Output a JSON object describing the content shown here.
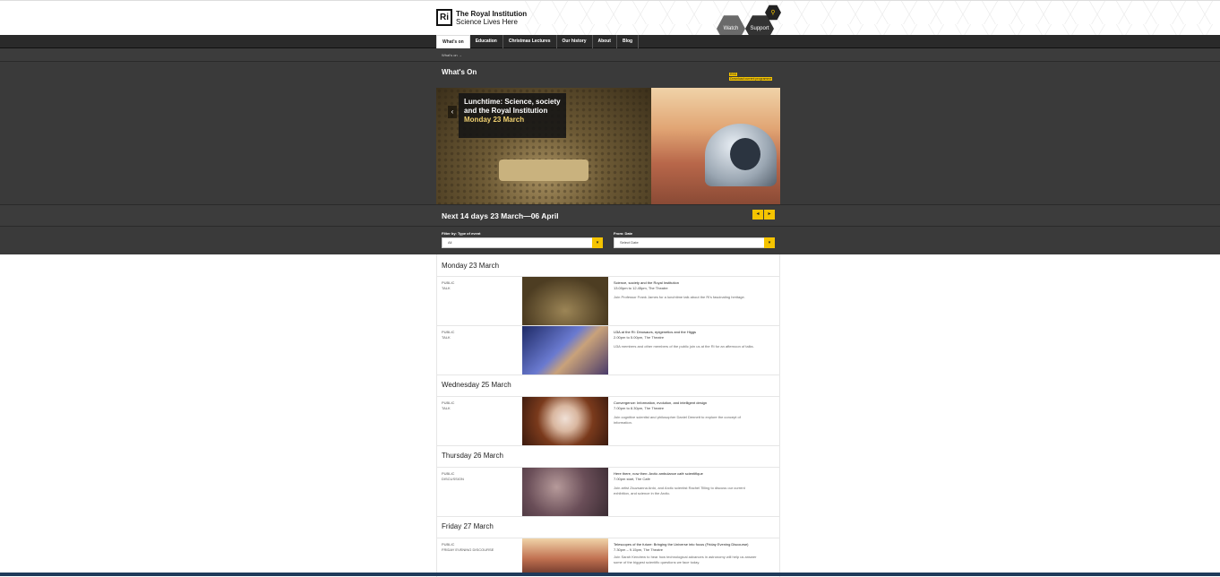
{
  "header": {
    "logo_mark": "Ri",
    "logo_line1": "The Royal Institution",
    "logo_line2": "Science Lives Here",
    "watch_label": "Watch",
    "support_label": "Support",
    "small_hex_icon": "search-icon"
  },
  "nav": {
    "items": [
      "What's on",
      "Education",
      "Christmas Lectures",
      "Our history",
      "About",
      "Blog"
    ]
  },
  "breadcrumb": "What's on →",
  "page_title": "What's On",
  "rss_label": "RSS",
  "download_label": "Download current programme",
  "hero": {
    "title": "Lunchtime: Science, society and the Royal Institution",
    "date": "Monday 23 March",
    "prev_arrow": "‹"
  },
  "next_days": {
    "title": "Next 14 days 23 March—06 April",
    "prev": "◂",
    "next": "▸"
  },
  "filters": {
    "type_label": "Filter by: Type of event",
    "type_value": "All",
    "date_label": "From: Date",
    "date_value": "Select Date",
    "caret": "▾"
  },
  "days": [
    {
      "label": "Monday 23 March"
    },
    {
      "label": "Wednesday 25 March"
    },
    {
      "label": "Thursday 26 March"
    },
    {
      "label": "Friday 27 March"
    }
  ],
  "events": [
    {
      "type1": "PUBLIC",
      "type2": "TALK",
      "title": "Science, society and the Royal Institution",
      "time": "13.00pm to 12.45pm, The Theatre",
      "blurb": "Join Professor Frank James for a lunchtime talk about the Ri's fascinating heritage."
    },
    {
      "type1": "PUBLIC",
      "type2": "TALK",
      "title": "U3A at the Ri: Dinosaurs, epigenetics and the Higgs",
      "time": "2.00pm to 5.00pm, The Theatre",
      "blurb": "U3A members and other members of the public join us at the Ri for an afternoon of talks."
    },
    {
      "type1": "PUBLIC",
      "type2": "TALK",
      "title": "Convergence: Information, evolution, and intelligent design",
      "time": "7.00pm to 8.30pm, The Theatre",
      "blurb": "Join cognitive scientist and philosopher Daniel Dennett to explore the concept of information."
    },
    {
      "type1": "PUBLIC",
      "type2": "DISCUSSION",
      "title": "Here there, now then: Arctic ambulance café scientifique",
      "time": "7.00pm start, The Café",
      "blurb": "Join artist Zsuzsanna Ardó, and Arctic scientist Rachel Tilling to discuss our current exhibition, and science in the Arctic."
    },
    {
      "type1": "PUBLIC",
      "type2": "FRIDAY EVENING DISCOURSE",
      "title": "Telescopes of the future: Bringing the Universe into focus (Friday Evening Discourse)",
      "time": "7.30pm – 9.15pm, The Theatre",
      "blurb": "Join Sarah Kendrew to hear how technological advances in astronomy will help us answer some of the biggest scientific questions we face today."
    }
  ]
}
